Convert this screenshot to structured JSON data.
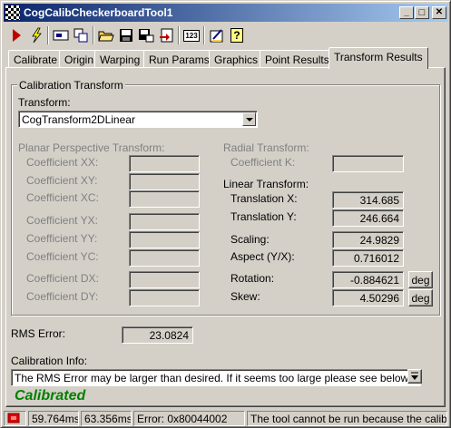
{
  "window": {
    "title": "CogCalibCheckerboardTool1",
    "controls": {
      "minimize": "_",
      "maximize": "□",
      "close": "✕"
    }
  },
  "toolbar": {
    "icons": [
      "run-icon",
      "lightning-icon",
      "image-icon",
      "copy-icon",
      "open-folder-icon",
      "save-icon",
      "save-as-icon",
      "reset-icon",
      "counter-icon",
      "edit-icon",
      "help-icon"
    ],
    "counter_label": "123",
    "help_label": "?"
  },
  "tabs": [
    "Calibrate",
    "Origin",
    "Warping",
    "Run Params",
    "Graphics",
    "Point Results",
    "Transform Results"
  ],
  "active_tab": "Transform Results",
  "calibration_transform": {
    "group_title": "Calibration Transform",
    "transform_label": "Transform:",
    "transform_value": "CogTransform2DLinear"
  },
  "planar": {
    "title": "Planar Perspective Transform:",
    "coefficients": [
      {
        "label": "Coefficient XX:",
        "value": ""
      },
      {
        "label": "Coefficient XY:",
        "value": ""
      },
      {
        "label": "Coefficient XC:",
        "value": ""
      },
      {
        "label": "Coefficient YX:",
        "value": ""
      },
      {
        "label": "Coefficient YY:",
        "value": ""
      },
      {
        "label": "Coefficient YC:",
        "value": ""
      },
      {
        "label": "Coefficient DX:",
        "value": ""
      },
      {
        "label": "Coefficient DY:",
        "value": ""
      }
    ]
  },
  "radial": {
    "title": "Radial Transform:",
    "coefficient_k_label": "Coefficient K:",
    "coefficient_k_value": ""
  },
  "linear": {
    "title": "Linear Transform:",
    "translation_x_label": "Translation X:",
    "translation_x": "314.685",
    "translation_y_label": "Translation Y:",
    "translation_y": "246.664",
    "scaling_label": "Scaling:",
    "scaling": "24.9829",
    "aspect_label": "Aspect (Y/X):",
    "aspect": "0.716012",
    "rotation_label": "Rotation:",
    "rotation": "-0.884621",
    "skew_label": "Skew:",
    "skew": "4.50296",
    "deg_label": "deg"
  },
  "rms": {
    "label": "RMS Error:",
    "value": "23.0824"
  },
  "calibration_info": {
    "label": "Calibration Info:",
    "text": "The RMS Error may be larger than desired.  If it seems too large please see below for a list"
  },
  "status_text": "Calibrated",
  "statusbar": {
    "time1": "59.764ms",
    "time2": "63.356ms",
    "error": "Error: 0x80044002",
    "message": "The tool cannot be run because the calibration has r"
  },
  "colors": {
    "title_start": "#0a246a",
    "title_end": "#a6caf0",
    "calibrated": "#008000",
    "face": "#d4d0c8"
  }
}
